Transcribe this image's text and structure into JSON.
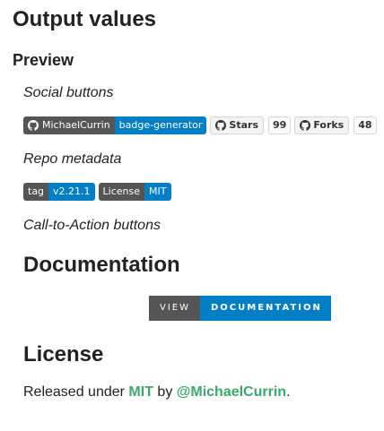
{
  "title": "Output values",
  "preview": {
    "heading": "Preview",
    "social_label": "Social buttons",
    "social_badges": {
      "repo_owner": "MichaelCurrin",
      "repo_name": "badge-generator",
      "stars_label": "Stars",
      "stars_count": "99",
      "forks_label": "Forks",
      "forks_count": "48"
    },
    "metadata_label": "Repo metadata",
    "metadata_badges": {
      "tag_label": "tag",
      "tag_value": "v2.21.1",
      "license_label": "License",
      "license_value": "MIT"
    },
    "cta_label": "Call-to-Action buttons"
  },
  "documentation": {
    "heading": "Documentation",
    "button_left": "VIEW",
    "button_right": "DOCUMENTATION"
  },
  "license": {
    "heading": "License",
    "text_prefix": "Released under ",
    "license_link": "MIT",
    "text_by": " by ",
    "author_link": "@MichaelCurrin",
    "text_suffix": "."
  },
  "colors": {
    "badge_dark": "#555555",
    "badge_blue": "#007ec6",
    "link_green": "#39a86b"
  },
  "icons": {
    "github": "github-octocat-icon"
  }
}
